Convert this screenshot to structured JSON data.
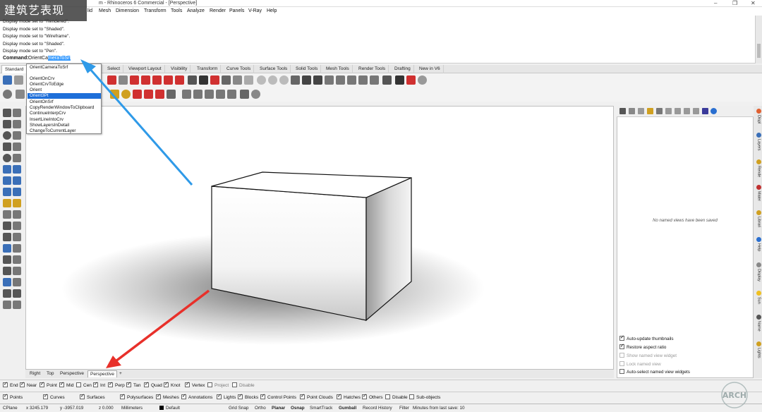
{
  "watermark": {
    "logo_text": "建筑艺表现",
    "seal_text": "ARCH"
  },
  "app": {
    "title_fragment": "m - Rhinoceros 6 Commercial - [Perspective]",
    "window_controls": [
      "–",
      "❐",
      "✕"
    ]
  },
  "menu": {
    "items": [
      "lid",
      "Mesh",
      "Dimension",
      "Transform",
      "Tools",
      "Analyze",
      "Render",
      "Panels",
      "V-Ray",
      "Help"
    ]
  },
  "command_history": {
    "lines": [
      "Display mode set to \"Rendered\".",
      "Display mode set to \"Shaded\".",
      "Display mode set to \"Wireframe\".",
      "Display mode set to \"Shaded\".",
      "Display mode set to \"Pen\"."
    ],
    "prompt_label": "Command:",
    "input_typed": "OrientCa",
    "input_autocomplete": "meraToSrf"
  },
  "autocomplete": {
    "items": [
      "OrientCameraToSrf",
      "",
      "OrientOnCrv",
      "OrientCrvToEdge",
      "Orient",
      "Orient3Pt",
      "OrientOnSrf",
      "CopyRenderWindowToClipboard",
      "ContinueInterpCrv",
      "InsertLineIntoCrv",
      "ShowLayersInDetail",
      "ChangeToCurrentLayer"
    ],
    "selected_index": 5
  },
  "toolbar_tabs": {
    "items": [
      "Standard",
      "Select",
      "Viewport Layout",
      "Visibility",
      "Transform",
      "Curve Tools",
      "Surface Tools",
      "Solid Tools",
      "Mesh Tools",
      "Render Tools",
      "Drafting",
      "New in V6"
    ],
    "active": "Standard"
  },
  "viewport_tabs": {
    "items": [
      "Right",
      "Top",
      "Perspective",
      "Perspective",
      "+"
    ],
    "active_index": 3
  },
  "named_views_panel": {
    "empty_message": "No named views have been saved",
    "options": [
      {
        "label": "Auto-update thumbnails",
        "checked": true,
        "enabled": true
      },
      {
        "label": "Restore aspect ratio",
        "checked": true,
        "enabled": true
      },
      {
        "label": "Show named view widget",
        "checked": false,
        "enabled": false
      },
      {
        "label": "Lock named view",
        "checked": false,
        "enabled": false
      },
      {
        "label": "Auto-select named view widgets",
        "checked": false,
        "enabled": true
      }
    ]
  },
  "right_tabs": [
    "Displ",
    "Layers",
    "Rende",
    "Mater",
    "Librari",
    "Help",
    "Display",
    "Sun",
    "Name",
    "Lights"
  ],
  "osnaps": [
    {
      "label": "End",
      "checked": true
    },
    {
      "label": "Near",
      "checked": true
    },
    {
      "label": "Point",
      "checked": true
    },
    {
      "label": "Mid",
      "checked": true
    },
    {
      "label": "Cen",
      "checked": false
    },
    {
      "label": "Int",
      "checked": true
    },
    {
      "label": "Perp",
      "checked": true
    },
    {
      "label": "Tan",
      "checked": true
    },
    {
      "label": "Quad",
      "checked": true
    },
    {
      "label": "Knot",
      "checked": true
    },
    {
      "label": "Vertex",
      "checked": true
    },
    {
      "label": "Project",
      "checked": false
    },
    {
      "label": "Disable",
      "checked": false
    }
  ],
  "selection_filters": [
    {
      "label": "Points",
      "checked": true
    },
    {
      "label": "Curves",
      "checked": true
    },
    {
      "label": "Surfaces",
      "checked": true
    },
    {
      "label": "Polysurfaces",
      "checked": true
    },
    {
      "label": "Meshes",
      "checked": true
    },
    {
      "label": "Annotations",
      "checked": true
    },
    {
      "label": "Lights",
      "checked": true
    },
    {
      "label": "Blocks",
      "checked": true
    },
    {
      "label": "Control Points",
      "checked": true
    },
    {
      "label": "Point Clouds",
      "checked": true
    },
    {
      "label": "Hatches",
      "checked": true
    },
    {
      "label": "Others",
      "checked": true
    },
    {
      "label": "Disable",
      "checked": false
    },
    {
      "label": "Sub-objects",
      "checked": false
    }
  ],
  "status_bar": {
    "cplane": "CPlane",
    "x": "x 3245.179",
    "y": "y -3957.019",
    "z": "z 0.000",
    "units": "Millimeters",
    "layer": "Default",
    "grid_snap": "Grid Snap",
    "ortho": "Ortho",
    "planar": "Planar",
    "osnap": "Osnap",
    "smarttrack": "SmartTrack",
    "gumball": "Gumball",
    "record_history": "Record History",
    "filter": "Filter",
    "minutes": "Minutes from last save: 10"
  },
  "colors": {
    "selection_blue": "#1e6fd9",
    "arrow_blue": "#2f9ae8",
    "arrow_red": "#e8302a"
  }
}
